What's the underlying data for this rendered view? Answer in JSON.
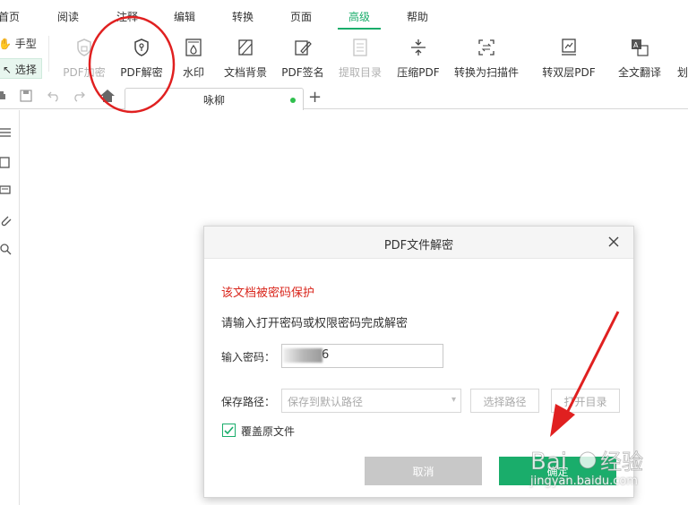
{
  "menu": {
    "tabs": [
      "首页",
      "阅读",
      "注释",
      "编辑",
      "转换",
      "页面",
      "高级",
      "帮助"
    ],
    "active": "高级"
  },
  "toolbar": {
    "hand_label": "手型",
    "select_label": "选择",
    "tools": [
      {
        "label": "PDF加密",
        "icon": "lock-shield-icon",
        "disabled": true
      },
      {
        "label": "PDF解密",
        "icon": "key-shield-icon",
        "disabled": false
      },
      {
        "label": "水印",
        "icon": "watermark-icon",
        "disabled": false
      },
      {
        "label": "文档背景",
        "icon": "background-icon",
        "disabled": false
      },
      {
        "label": "PDF签名",
        "icon": "signature-icon",
        "disabled": false
      },
      {
        "label": "提取目录",
        "icon": "extract-toc-icon",
        "disabled": true
      },
      {
        "label": "压缩PDF",
        "icon": "compress-icon",
        "disabled": false
      },
      {
        "label": "转换为扫描件",
        "icon": "scan-convert-icon",
        "disabled": false
      },
      {
        "label": "转双层PDF",
        "icon": "dual-layer-icon",
        "disabled": false
      },
      {
        "label": "全文翻译",
        "icon": "translate-icon",
        "disabled": false
      },
      {
        "label": "划",
        "icon": "partial-icon",
        "disabled": false
      }
    ]
  },
  "tabbar": {
    "doc_title": "咏柳",
    "new_tab": "+"
  },
  "dialog": {
    "title": "PDF文件解密",
    "warning": "该文档被密码保护",
    "hint": "请输入打开密码或权限密码完成解密",
    "password_label": "输入密码：",
    "password_value": "6",
    "save_path_label": "保存路径：",
    "save_path_placeholder": "保存到默认路径",
    "choose_path_button": "选择路径",
    "open_dir_button": "打开目录",
    "overwrite_label": "覆盖原文件",
    "overwrite_checked": true,
    "cancel_button": "取消",
    "ok_button": "确定"
  },
  "colors": {
    "accent": "#1aad6b",
    "warning": "#d9261c",
    "annotation": "#e02020"
  },
  "watermark": "jingyan.baidu.com"
}
